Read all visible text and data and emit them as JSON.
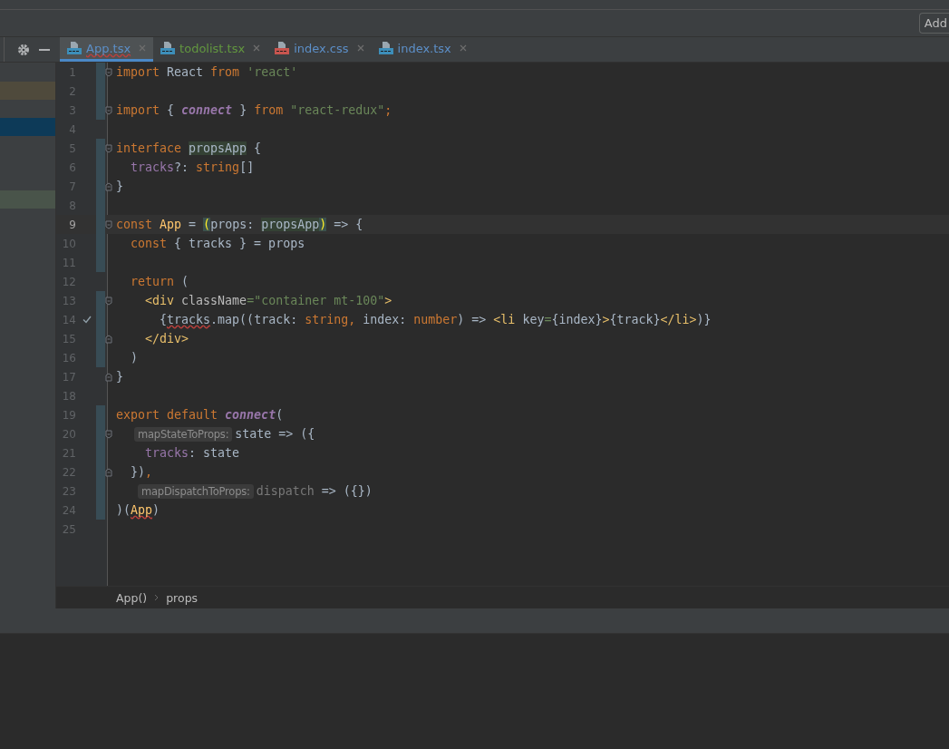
{
  "toolbar": {
    "button": "Add"
  },
  "tabs": [
    {
      "label": "App.tsx",
      "kind": "tsx",
      "selected": true,
      "error": true,
      "color": "#5c8fc8"
    },
    {
      "label": "todolist.tsx",
      "kind": "tsx",
      "selected": false,
      "error": false,
      "color": "#62973f"
    },
    {
      "label": "index.css",
      "kind": "css",
      "selected": false,
      "error": false,
      "color": "#5c8fc8"
    },
    {
      "label": "index.tsx",
      "kind": "tsx",
      "selected": false,
      "error": false,
      "color": "#5c8fc8"
    }
  ],
  "editor": {
    "lines": [
      {
        "number": "1",
        "current": false,
        "check": false,
        "changed": true,
        "fold_start": true,
        "fold_end": false,
        "tokens": [
          {
            "kind": "kw",
            "text": "import"
          },
          {
            "kind": "pl",
            "text": " React "
          },
          {
            "kind": "kw",
            "text": "from "
          },
          {
            "kind": "str",
            "text": "'react'"
          }
        ]
      },
      {
        "number": "2",
        "current": false,
        "check": false,
        "changed": true,
        "fold_start": false,
        "fold_end": false
      },
      {
        "number": "3",
        "current": false,
        "check": false,
        "changed": true,
        "fold_start": true,
        "fold_end": false,
        "tokens": [
          {
            "kind": "kw",
            "text": "import"
          },
          {
            "kind": "pl",
            "text": " { "
          },
          {
            "kind": "fn",
            "text": "connect"
          },
          {
            "kind": "pl",
            "text": " } "
          },
          {
            "kind": "kw",
            "text": "from "
          },
          {
            "kind": "str",
            "text": "\"react-redux\""
          },
          {
            "kind": "kw",
            "text": ";"
          }
        ]
      },
      {
        "number": "4",
        "current": false,
        "check": false,
        "changed": false,
        "fold_start": false,
        "fold_end": false
      },
      {
        "number": "5",
        "current": false,
        "check": false,
        "changed": true,
        "fold_start": true,
        "fold_end": false,
        "tokens": [
          {
            "kind": "kw",
            "text": "interface "
          },
          {
            "kind": "ref",
            "text": "propsApp"
          },
          {
            "kind": "pl",
            "text": " {"
          }
        ]
      },
      {
        "number": "6",
        "current": false,
        "check": false,
        "changed": true,
        "fold_start": false,
        "fold_end": false,
        "tokens": [
          {
            "kind": "prop",
            "text": "  tracks"
          },
          {
            "kind": "pl",
            "text": "?: "
          },
          {
            "kind": "kw",
            "text": "string"
          },
          {
            "kind": "pl",
            "text": "[]"
          }
        ]
      },
      {
        "number": "7",
        "current": false,
        "check": false,
        "changed": true,
        "fold_start": false,
        "fold_end": true,
        "tokens": [
          {
            "kind": "pl",
            "text": "}"
          }
        ]
      },
      {
        "number": "8",
        "current": false,
        "check": false,
        "changed": true,
        "fold_start": false,
        "fold_end": false
      },
      {
        "number": "9",
        "current": true,
        "check": false,
        "changed": true,
        "fold_start": true,
        "fold_end": false,
        "tokens": [
          {
            "kind": "kw",
            "text": "const "
          },
          {
            "kind": "decl",
            "text": "App"
          },
          {
            "kind": "pl",
            "text": " = "
          },
          {
            "kind": "brace",
            "text": "("
          },
          {
            "kind": "pl",
            "text": "props: "
          },
          {
            "kind": "ref",
            "text": "propsApp"
          },
          {
            "kind": "brace",
            "text": ")"
          },
          {
            "kind": "pl",
            "text": " => {"
          }
        ]
      },
      {
        "number": "10",
        "current": false,
        "check": false,
        "changed": true,
        "fold_start": false,
        "fold_end": false,
        "tokens": [
          {
            "kind": "kw",
            "text": "  const"
          },
          {
            "kind": "pl",
            "text": " { tracks } = props"
          }
        ]
      },
      {
        "number": "11",
        "current": false,
        "check": false,
        "changed": true,
        "fold_start": false,
        "fold_end": false
      },
      {
        "number": "12",
        "current": false,
        "check": false,
        "changed": false,
        "fold_start": false,
        "fold_end": false,
        "tokens": [
          {
            "kind": "kw",
            "text": "  return"
          },
          {
            "kind": "pl",
            "text": " ("
          }
        ]
      },
      {
        "number": "13",
        "current": false,
        "check": false,
        "changed": true,
        "fold_start": true,
        "fold_end": false,
        "tokens": [
          {
            "kind": "tag",
            "text": "    <div "
          },
          {
            "kind": "attr",
            "text": "className"
          },
          {
            "kind": "str",
            "text": "=\"container mt-100\""
          },
          {
            "kind": "tag",
            "text": ">"
          }
        ]
      },
      {
        "number": "14",
        "current": false,
        "check": true,
        "changed": true,
        "fold_start": false,
        "fold_end": false,
        "tokens": [
          {
            "kind": "pl",
            "text": "      {"
          },
          {
            "kind": "err",
            "text": "tracks"
          },
          {
            "kind": "pl",
            "text": ".map((track: "
          },
          {
            "kind": "kw",
            "text": "string,"
          },
          {
            "kind": "pl",
            "text": " index: "
          },
          {
            "kind": "kw",
            "text": "number"
          },
          {
            "kind": "pl",
            "text": ") => "
          },
          {
            "kind": "tag",
            "text": "<li"
          },
          {
            "kind": "pl",
            "text": " key"
          },
          {
            "kind": "str",
            "text": "="
          },
          {
            "kind": "pl",
            "text": "{index}"
          },
          {
            "kind": "tag",
            "text": ">"
          },
          {
            "kind": "pl",
            "text": "{track}"
          },
          {
            "kind": "tag",
            "text": "</li>"
          },
          {
            "kind": "pl",
            "text": ")}"
          }
        ]
      },
      {
        "number": "15",
        "current": false,
        "check": false,
        "changed": true,
        "fold_start": false,
        "fold_end": true,
        "tokens": [
          {
            "kind": "tag",
            "text": "    </div>"
          }
        ]
      },
      {
        "number": "16",
        "current": false,
        "check": false,
        "changed": true,
        "fold_start": false,
        "fold_end": false,
        "tokens": [
          {
            "kind": "pl",
            "text": "  )"
          }
        ]
      },
      {
        "number": "17",
        "current": false,
        "check": false,
        "changed": false,
        "fold_start": false,
        "fold_end": true,
        "tokens": [
          {
            "kind": "pl",
            "text": "}"
          }
        ]
      },
      {
        "number": "18",
        "current": false,
        "check": false,
        "changed": false,
        "fold_start": false,
        "fold_end": false
      },
      {
        "number": "19",
        "current": false,
        "check": false,
        "changed": true,
        "fold_start": false,
        "fold_end": false,
        "tokens": [
          {
            "kind": "kw",
            "text": "export default "
          },
          {
            "kind": "fn",
            "text": "connect"
          },
          {
            "kind": "pl",
            "text": "("
          }
        ]
      },
      {
        "number": "20",
        "current": false,
        "check": false,
        "changed": true,
        "fold_start": true,
        "fold_end": false,
        "tokens": [
          {
            "kind": "hint",
            "text": "mapStateToProps:"
          },
          {
            "kind": "pl",
            "text": "state => ({"
          }
        ]
      },
      {
        "number": "21",
        "current": false,
        "check": false,
        "changed": true,
        "fold_start": false,
        "fold_end": false,
        "tokens": [
          {
            "kind": "prop",
            "text": "    tracks"
          },
          {
            "kind": "pl",
            "text": ": state"
          }
        ]
      },
      {
        "number": "22",
        "current": false,
        "check": false,
        "changed": true,
        "fold_start": false,
        "fold_end": true,
        "tokens": [
          {
            "kind": "pl",
            "text": "  })"
          },
          {
            "kind": "kw",
            "text": ","
          }
        ]
      },
      {
        "number": "23",
        "current": false,
        "check": false,
        "changed": true,
        "fold_start": false,
        "fold_end": false,
        "tokens": [
          {
            "kind": "hint",
            "text": "mapDispatchToProps:"
          },
          {
            "kind": "unused",
            "text": "dispatch"
          },
          {
            "kind": "pl",
            "text": " => ({})"
          }
        ]
      },
      {
        "number": "24",
        "current": false,
        "check": false,
        "changed": true,
        "fold_start": false,
        "fold_end": false,
        "tokens": [
          {
            "kind": "pl",
            "text": ")("
          },
          {
            "kind": "declerr",
            "text": "App"
          },
          {
            "kind": "pl",
            "text": ")"
          }
        ]
      },
      {
        "number": "25",
        "current": false,
        "check": false,
        "changed": false,
        "fold_start": false,
        "fold_end": false
      }
    ]
  },
  "breadcrumbs": [
    "App()",
    "props"
  ]
}
